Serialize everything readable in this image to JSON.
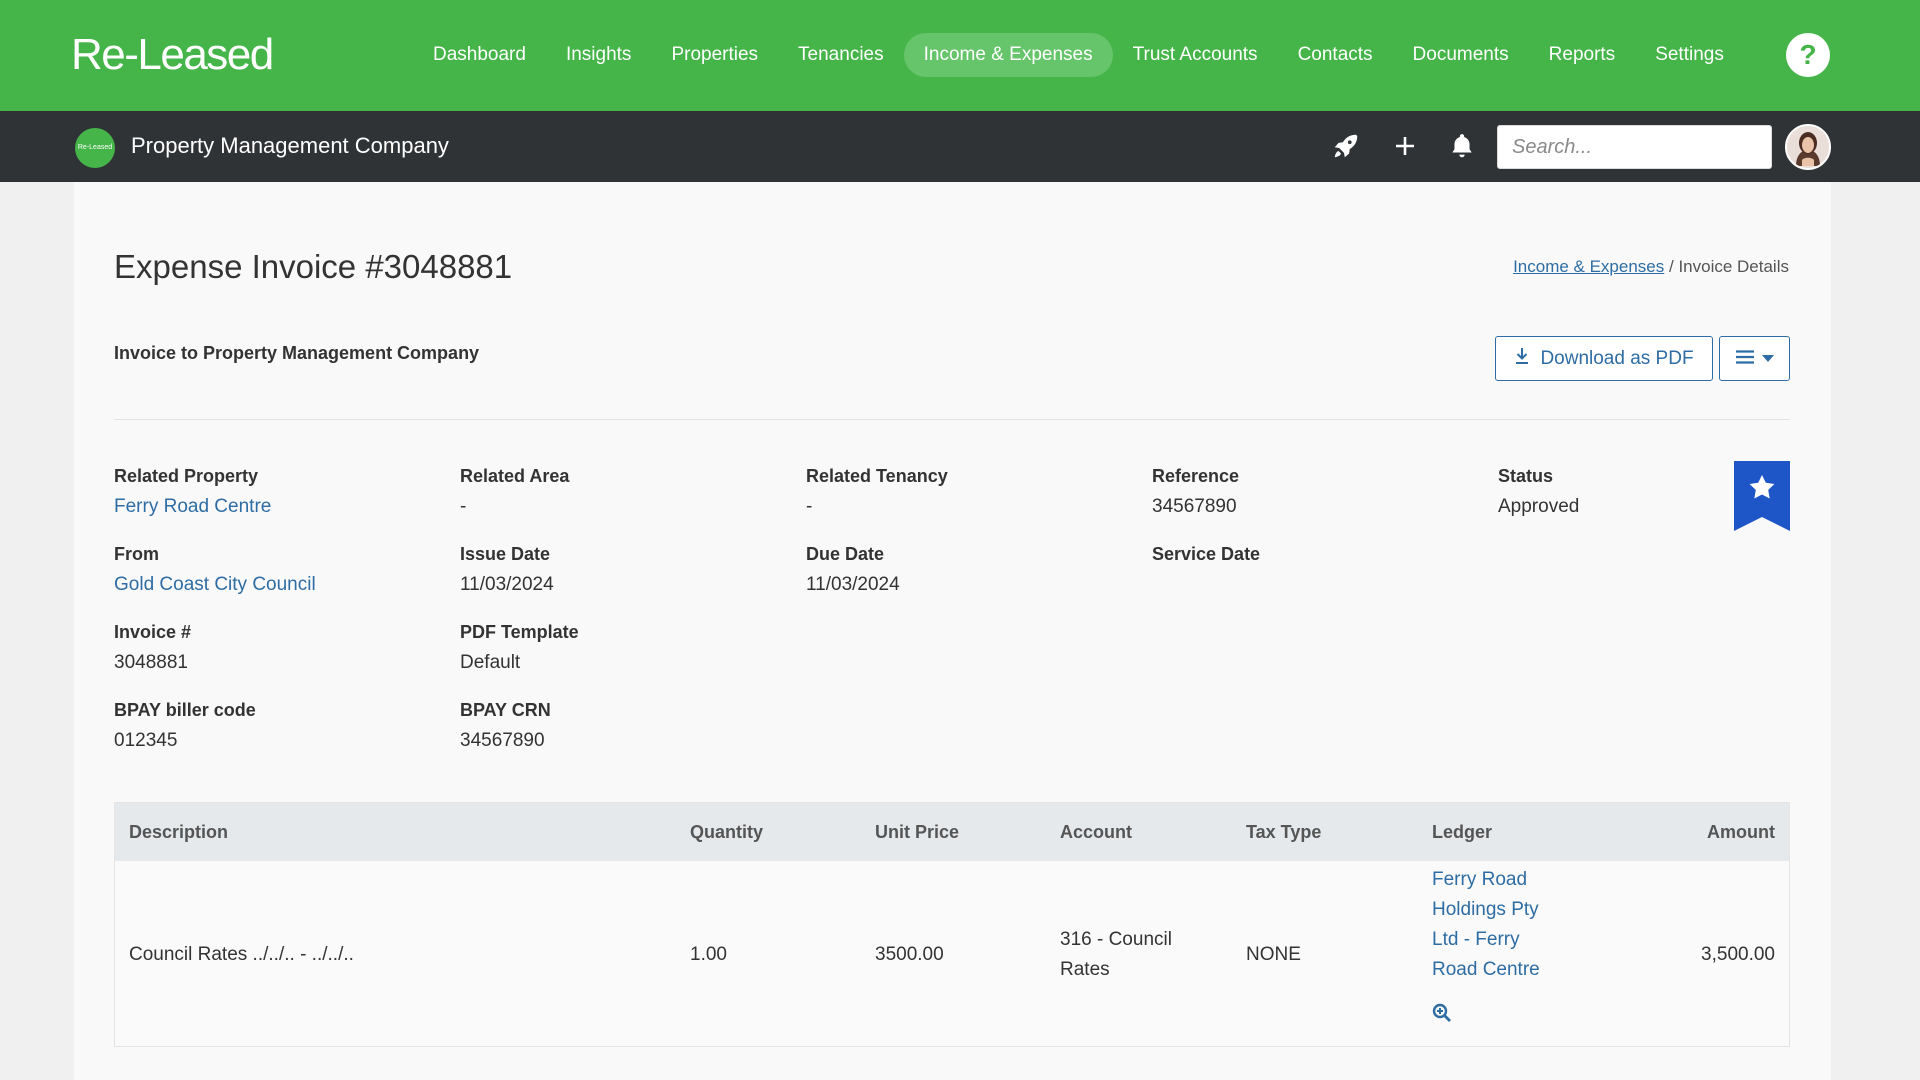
{
  "app": {
    "logo": "Re-Leased"
  },
  "nav": {
    "items": [
      {
        "label": "Dashboard",
        "active": false
      },
      {
        "label": "Insights",
        "active": false
      },
      {
        "label": "Properties",
        "active": false
      },
      {
        "label": "Tenancies",
        "active": false
      },
      {
        "label": "Income & Expenses",
        "active": true
      },
      {
        "label": "Trust Accounts",
        "active": false
      },
      {
        "label": "Contacts",
        "active": false
      },
      {
        "label": "Documents",
        "active": false
      },
      {
        "label": "Reports",
        "active": false
      },
      {
        "label": "Settings",
        "active": false
      }
    ],
    "help_label": "?"
  },
  "subbar": {
    "company_logo_text": "Re-Leased",
    "company_name": "Property Management Company",
    "search_placeholder": "Search..."
  },
  "page": {
    "title": "Expense Invoice #3048881",
    "breadcrumb": {
      "link": "Income & Expenses",
      "separator": " / ",
      "current": "Invoice Details"
    },
    "invoice_to": "Invoice to Property Management Company",
    "download_label": "Download as PDF"
  },
  "details": {
    "related_property": {
      "label": "Related Property",
      "value": "Ferry Road Centre"
    },
    "related_area": {
      "label": "Related Area",
      "value": "-"
    },
    "related_tenancy": {
      "label": "Related Tenancy",
      "value": "-"
    },
    "reference": {
      "label": "Reference",
      "value": "34567890"
    },
    "status": {
      "label": "Status",
      "value": "Approved"
    },
    "from": {
      "label": "From",
      "value": "Gold Coast City Council"
    },
    "issue_date": {
      "label": "Issue Date",
      "value": "11/03/2024"
    },
    "due_date": {
      "label": "Due Date",
      "value": "11/03/2024"
    },
    "service_date": {
      "label": "Service Date",
      "value": ""
    },
    "invoice_no": {
      "label": "Invoice #",
      "value": "3048881"
    },
    "pdf_template": {
      "label": "PDF Template",
      "value": "Default"
    },
    "bpay_biller": {
      "label": "BPAY biller code",
      "value": "012345"
    },
    "bpay_crn": {
      "label": "BPAY CRN",
      "value": "34567890"
    }
  },
  "table": {
    "headers": {
      "description": "Description",
      "quantity": "Quantity",
      "unit_price": "Unit Price",
      "account": "Account",
      "tax_type": "Tax Type",
      "ledger": "Ledger",
      "amount": "Amount"
    },
    "rows": [
      {
        "description": "Council Rates ../../.. - ../../..",
        "quantity": "1.00",
        "unit_price": "3500.00",
        "account_line1": "316 - Council",
        "account_line2": "Rates",
        "tax_type": "NONE",
        "ledger_line1": "Ferry Road",
        "ledger_line2": "Holdings Pty",
        "ledger_line3": "Ltd - Ferry",
        "ledger_line4": "Road Centre",
        "amount": "3,500.00"
      }
    ]
  },
  "colors": {
    "brand_green": "#45b549",
    "dark_bar": "#303336",
    "link_blue": "#2e6da4",
    "bookmark_blue": "#1f56c7"
  },
  "icons": [
    "rocket-icon",
    "plus-icon",
    "bell-icon",
    "download-icon",
    "menu-icon",
    "caret-down-icon",
    "star-bookmark-icon",
    "zoom-in-icon",
    "question-icon"
  ]
}
